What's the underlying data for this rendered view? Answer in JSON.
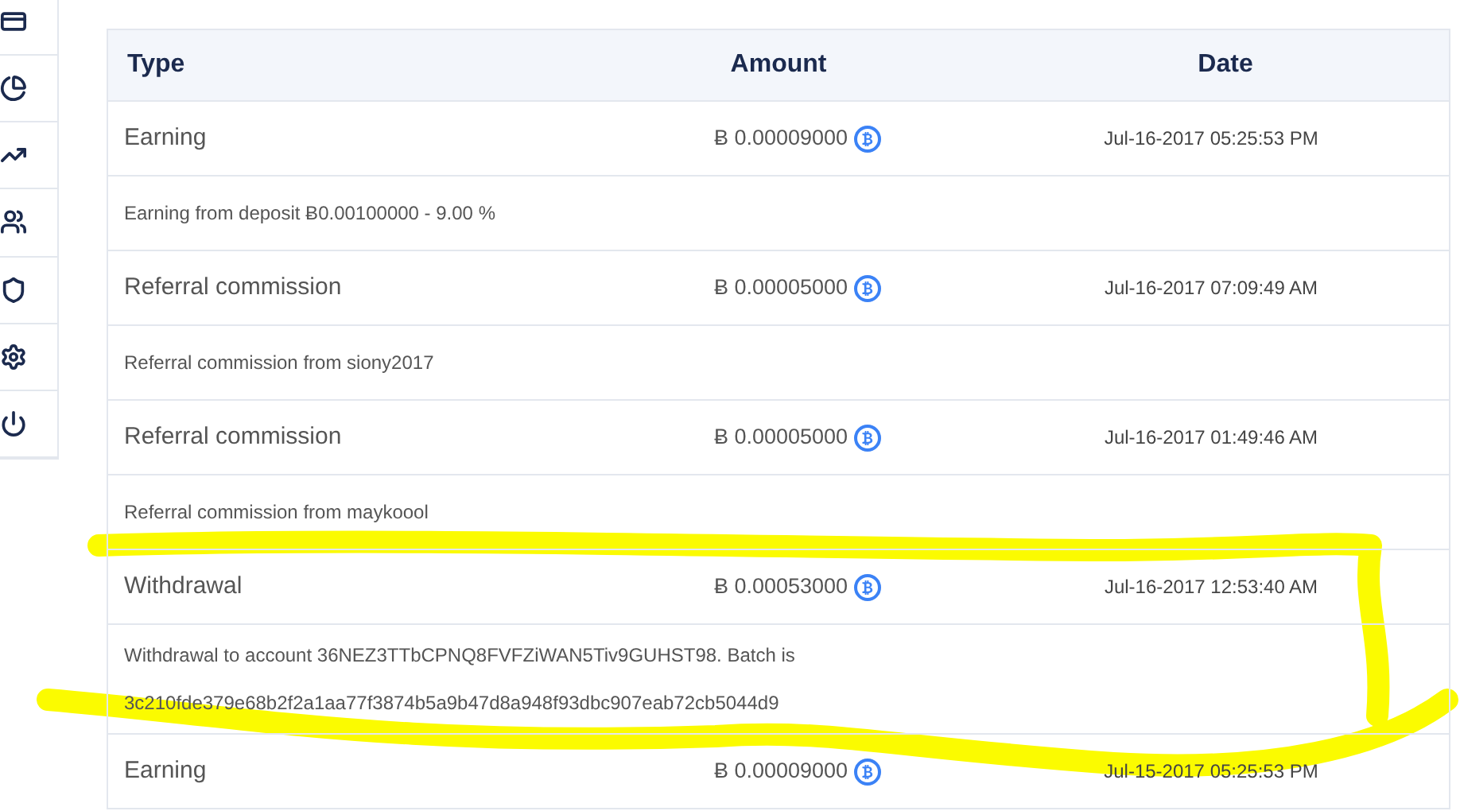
{
  "table": {
    "columns": [
      "Type",
      "Amount",
      "Date"
    ],
    "rows": [
      {
        "type": "Earning",
        "amount": "Ƀ 0.00009000",
        "date": "Jul-16-2017 05:25:53 PM",
        "description": "Earning from deposit Ƀ0.00100000 - 9.00 %"
      },
      {
        "type": "Referral commission",
        "amount": "Ƀ 0.00005000",
        "date": "Jul-16-2017 07:09:49 AM",
        "description": "Referral commission from siony2017"
      },
      {
        "type": "Referral commission",
        "amount": "Ƀ 0.00005000",
        "date": "Jul-16-2017 01:49:46 AM",
        "description": "Referral commission from maykoool"
      },
      {
        "type": "Withdrawal",
        "amount": "Ƀ 0.00053000",
        "date": "Jul-16-2017 12:53:40 AM",
        "description": "Withdrawal to account 36NEZ3TTbCPNQ8FVFZiWAN5Tiv9GUHST98. Batch is 3c210fde379e68b2f2a1aa77f3874b5a9b47d8a948f93dbc907eab72cb5044d9"
      },
      {
        "type": "Earning",
        "amount": "Ƀ 0.00009000",
        "date": "Jul-15-2017 05:25:53 PM"
      }
    ]
  }
}
